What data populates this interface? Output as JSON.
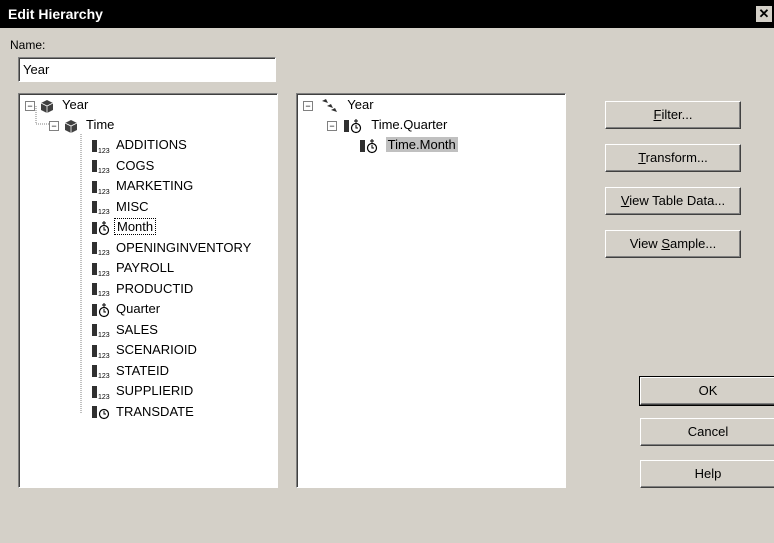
{
  "window": {
    "title": "Edit Hierarchy",
    "close_glyph": "✕"
  },
  "name_field": {
    "label": "Name:",
    "value": "Year"
  },
  "left_tree": {
    "root": "Year",
    "time": "Time",
    "items": [
      {
        "label": "ADDITIONS",
        "icon": "numeric-column-icon"
      },
      {
        "label": "COGS",
        "icon": "numeric-column-icon"
      },
      {
        "label": "MARKETING",
        "icon": "numeric-column-icon"
      },
      {
        "label": "MISC",
        "icon": "numeric-column-icon"
      },
      {
        "label": "Month",
        "icon": "time-level-icon",
        "selected": true
      },
      {
        "label": "OPENINGINVENTORY",
        "icon": "numeric-column-icon"
      },
      {
        "label": "PAYROLL",
        "icon": "numeric-column-icon"
      },
      {
        "label": "PRODUCTID",
        "icon": "numeric-column-icon"
      },
      {
        "label": "Quarter",
        "icon": "time-level-icon"
      },
      {
        "label": "SALES",
        "icon": "numeric-column-icon"
      },
      {
        "label": "SCENARIOID",
        "icon": "numeric-column-icon"
      },
      {
        "label": "STATEID",
        "icon": "numeric-column-icon"
      },
      {
        "label": "SUPPLIERID",
        "icon": "numeric-column-icon"
      },
      {
        "label": "TRANSDATE",
        "icon": "date-column-icon"
      }
    ]
  },
  "right_tree": {
    "root": "Year",
    "level1": "Time.Quarter",
    "level2": "Time.Month"
  },
  "buttons": {
    "filter": {
      "pre": "",
      "key": "F",
      "post": "ilter..."
    },
    "transform": {
      "pre": "",
      "key": "T",
      "post": "ransform..."
    },
    "view_table": {
      "pre": "",
      "key": "V",
      "post": "iew Table Data..."
    },
    "view_sample": {
      "pre": "View ",
      "key": "S",
      "post": "ample..."
    },
    "ok": "OK",
    "cancel": "Cancel",
    "help": "Help"
  }
}
